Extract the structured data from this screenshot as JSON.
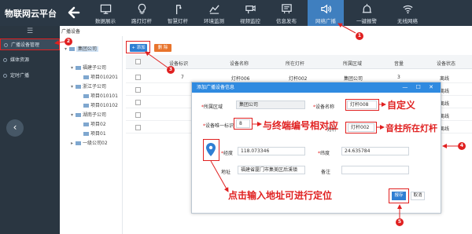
{
  "app": {
    "title": "物联网云平台"
  },
  "nav": [
    {
      "label": "数据展示",
      "icon": "monitor-icon"
    },
    {
      "label": "路灯灯杆",
      "icon": "bulb-icon"
    },
    {
      "label": "智慧灯杆",
      "icon": "light-pole-icon"
    },
    {
      "label": "环境监测",
      "icon": "environment-icon"
    },
    {
      "label": "视频监控",
      "icon": "camera-icon"
    },
    {
      "label": "信息发布",
      "icon": "info-board-icon"
    },
    {
      "label": "网络广播",
      "icon": "speaker-icon",
      "active": true
    },
    {
      "label": "一键报警",
      "icon": "alarm-icon"
    },
    {
      "label": "无线网络",
      "icon": "wifi-icon"
    }
  ],
  "sidebar": {
    "items": [
      {
        "label": "广播设备管理",
        "active": true
      },
      {
        "label": "媒体资源"
      },
      {
        "label": "定时广播"
      }
    ]
  },
  "breadcrumb": "广播设备",
  "tree": [
    {
      "label": "集团公司",
      "level": 0,
      "selected": true
    },
    {
      "label": "福建子公司",
      "level": 1
    },
    {
      "label": "项目010201",
      "level": 2
    },
    {
      "label": "浙江子公司",
      "level": 1
    },
    {
      "label": "项目010101",
      "level": 2
    },
    {
      "label": "项目010102",
      "level": 2
    },
    {
      "label": "湖南子公司",
      "level": 1
    },
    {
      "label": "项目02",
      "level": 2
    },
    {
      "label": "项目01",
      "level": 2
    },
    {
      "label": "一级公司02",
      "level": 1
    }
  ],
  "toolbar": {
    "add_label": "+ 添加",
    "delete_label": "删 除"
  },
  "table": {
    "columns": [
      "设备标识",
      "设备名称",
      "所在灯杆",
      "所属区域",
      "音量",
      "设备状态"
    ],
    "rows": [
      [
        "7",
        "灯杆006",
        "灯杆002",
        "集团公司",
        "3",
        "离线"
      ],
      [
        "",
        "",
        "",
        "",
        "3",
        "离线"
      ],
      [
        "",
        "",
        "",
        "",
        "",
        "离线"
      ],
      [
        "",
        "",
        "",
        "",
        "",
        "离线"
      ],
      [
        "",
        "",
        "",
        "",
        "",
        "离线"
      ]
    ]
  },
  "modal": {
    "title": "添加广播设备信息",
    "controls": "— ☐ ✕",
    "fields": {
      "area_label": "所属区域",
      "area_value": "集团公司",
      "name_label": "设备名称",
      "name_value": "灯杆008",
      "id_label": "设备唯一标识",
      "id_value": "8",
      "pole_label": "灯杆",
      "pole_value": "灯杆002",
      "lng_label": "经度",
      "lng_value": "118.073346",
      "lat_label": "纬度",
      "lat_value": "24.635784",
      "addr_label": "地址",
      "addr_value": "福建省厦门市集美区后溪镇",
      "remark_label": "备注"
    },
    "save_label": "报存",
    "cancel_label": "取消"
  },
  "annotations": {
    "custom": "自定义",
    "match_terminal": "与终端编号相对应",
    "pole_location": "音柱所在灯杆",
    "click_address": "点击输入地址可进行定位"
  },
  "badges": [
    "1",
    "2",
    "3",
    "4",
    "5"
  ],
  "colors": {
    "topbar": "#2b3845",
    "accent": "#2f7fd3",
    "annotation": "#e02020",
    "delete": "#e8742c"
  }
}
